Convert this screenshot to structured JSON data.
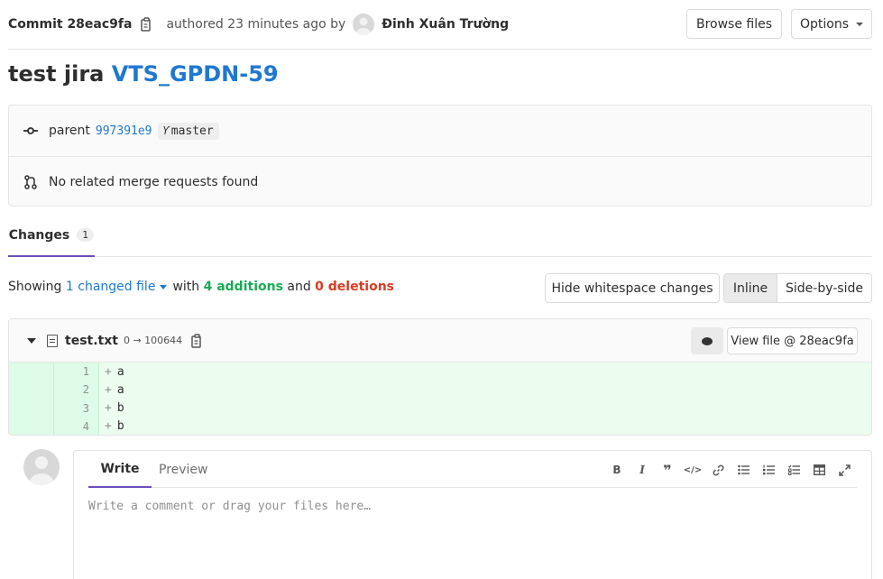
{
  "header": {
    "commit_label": "Commit",
    "commit_sha": "28eac9fa",
    "authored_text": "authored 23 minutes ago by",
    "author_name": "Đinh Xuân Trường",
    "browse_files_label": "Browse files",
    "options_label": "Options"
  },
  "title": {
    "text": "test jira",
    "issue": "VTS_GPDN-59"
  },
  "info": {
    "parent_label": "parent",
    "parent_sha": "997391e9",
    "branch": "master",
    "merge_requests_text": "No related merge requests found"
  },
  "tabs": {
    "changes_label": "Changes",
    "changes_count": "1"
  },
  "summary": {
    "showing": "Showing",
    "changed_files": "1 changed file",
    "with": "with",
    "additions": "4 additions",
    "and": "and",
    "deletions": "0 deletions",
    "hide_whitespace_label": "Hide whitespace changes",
    "inline_label": "Inline",
    "side_by_side_label": "Side-by-side"
  },
  "diff": {
    "file_name": "test.txt",
    "file_mode": "0 → 100644",
    "view_file_label": "View file @ 28eac9fa",
    "lines": [
      {
        "num": "1",
        "sign": "+",
        "text": "a"
      },
      {
        "num": "2",
        "sign": "+",
        "text": "a"
      },
      {
        "num": "3",
        "sign": "+",
        "text": "b"
      },
      {
        "num": "4",
        "sign": "+",
        "text": "b"
      }
    ]
  },
  "comment": {
    "write_tab": "Write",
    "preview_tab": "Preview",
    "placeholder": "Write a comment or drag your files here…",
    "tools": [
      "bold-icon",
      "italic-icon",
      "quote-icon",
      "code-icon",
      "link-icon",
      "bullet-list-icon",
      "numbered-list-icon",
      "task-list-icon",
      "table-icon",
      "fullscreen-icon"
    ]
  },
  "colors": {
    "link": "#1f78d1",
    "addition": "#1aaa55",
    "deletion": "#db3b21",
    "tab_active": "#6b4fbb",
    "diff_added_bg": "#ecfdf0"
  }
}
